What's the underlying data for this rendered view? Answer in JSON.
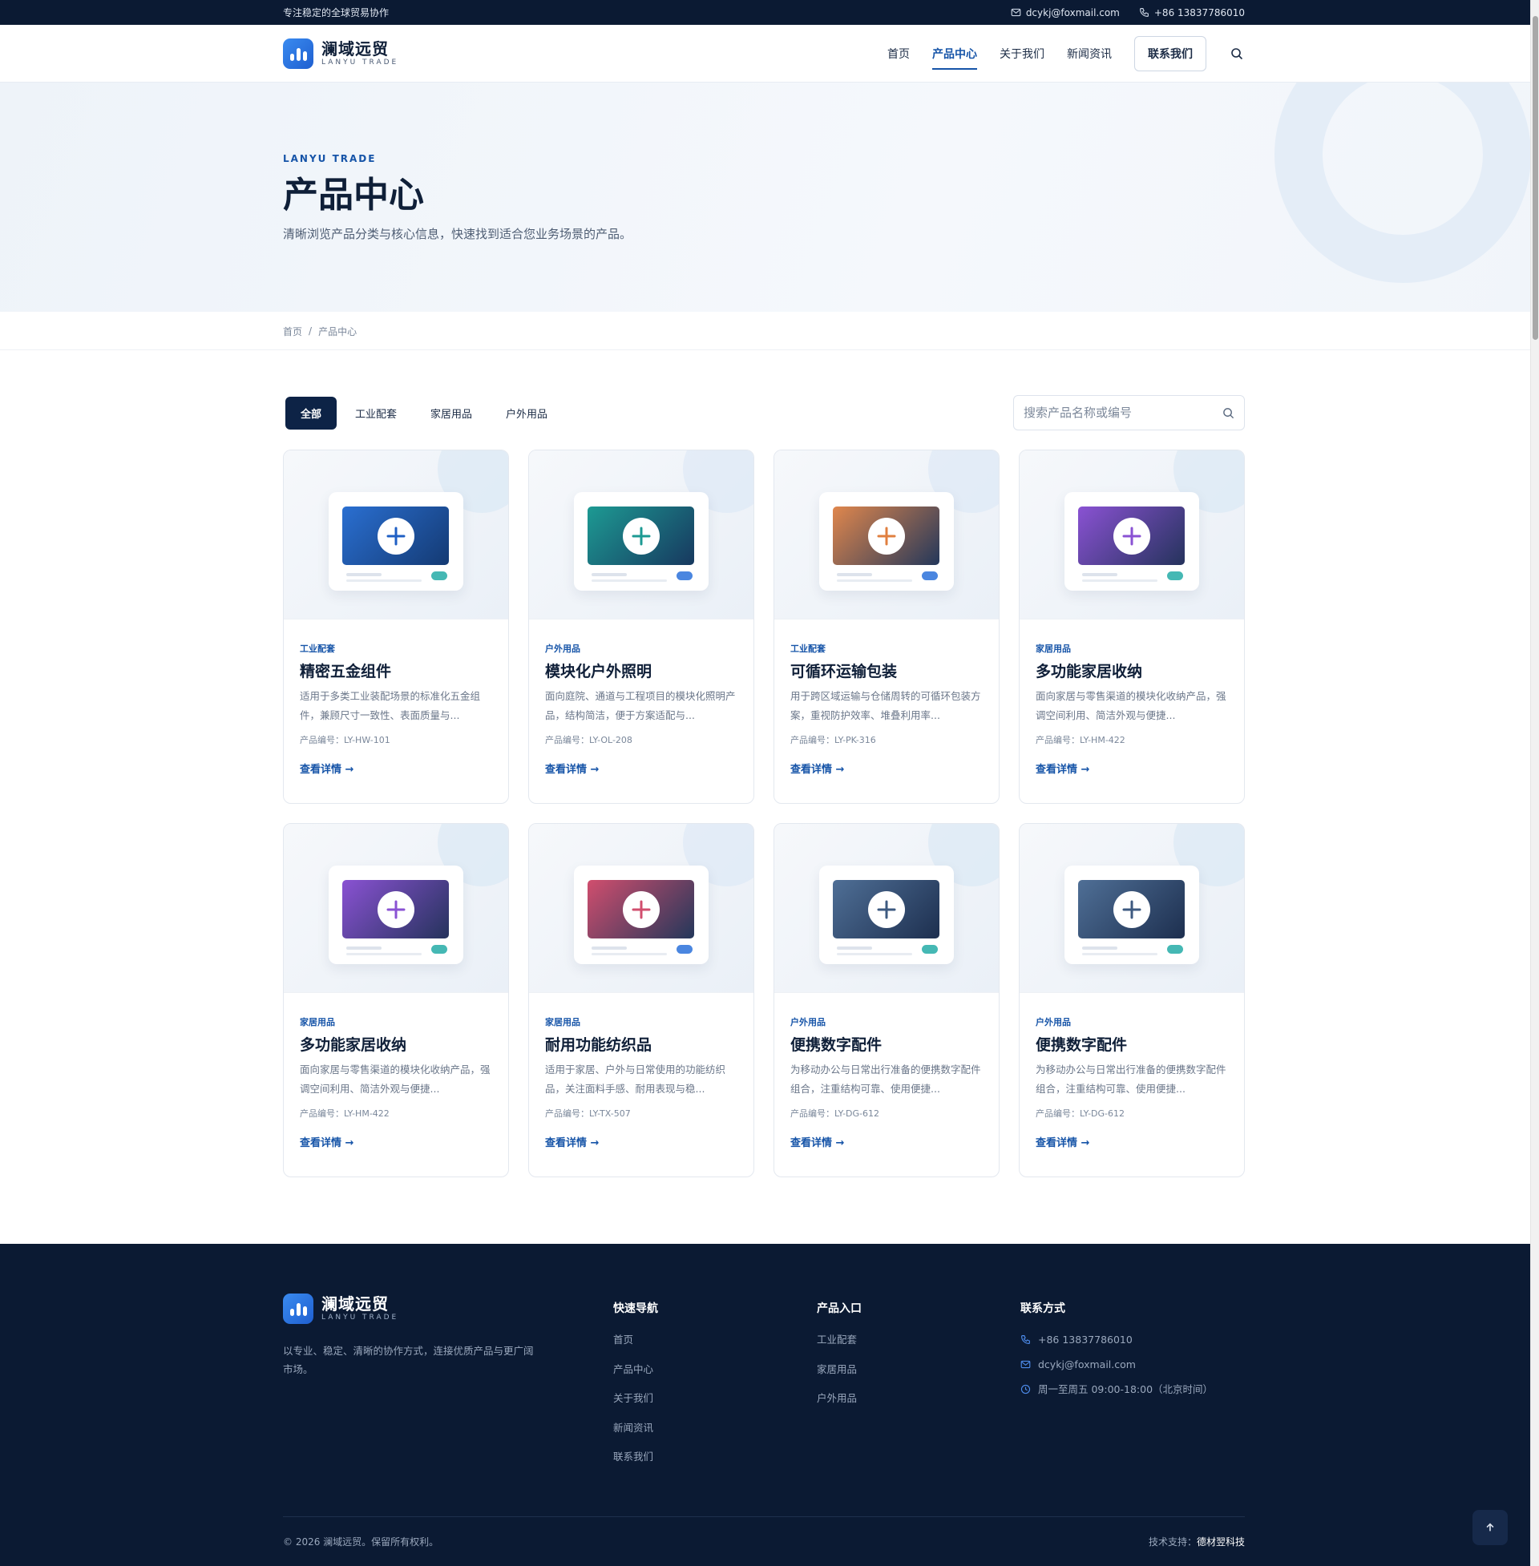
{
  "topbar": {
    "slogan": "专注稳定的全球贸易协作",
    "email": "dcykj@foxmail.com",
    "phone": "+86 13837786010"
  },
  "brand": {
    "name_cn": "澜域远贸",
    "name_en": "LANYU TRADE"
  },
  "nav": {
    "items": [
      "首页",
      "产品中心",
      "关于我们",
      "新闻资讯"
    ],
    "active_index": 1,
    "contact_label": "联系我们"
  },
  "hero": {
    "eyebrow": "LANYU TRADE",
    "title": "产品中心",
    "description": "清晰浏览产品分类与核心信息，快速找到适合您业务场景的产品。"
  },
  "breadcrumb": {
    "home": "首页",
    "separator": "/",
    "current": "产品中心"
  },
  "filters": {
    "tabs": [
      "全部",
      "工业配套",
      "家居用品",
      "户外用品"
    ],
    "active_index": 0,
    "search_placeholder": "搜索产品名称或编号"
  },
  "products": [
    {
      "tag": "工业配套",
      "title": "精密五金组件",
      "desc": "适用于多类工业装配场景的标准化五金组件，兼顾尺寸一致性、表面质量与...",
      "code": "产品编号：LY-HW-101",
      "link": "查看详情 →",
      "color_a": "#2a6fd1",
      "color_b": "#143a73",
      "plus_color": "#1f5fc4",
      "blob": "#d6e6f4",
      "pill": "#45b8b4"
    },
    {
      "tag": "户外用品",
      "title": "模块化户外照明",
      "desc": "面向庭院、通道与工程项目的模块化照明产品，结构简洁，便于方案适配与...",
      "code": "产品编号：LY-OL-208",
      "link": "查看详情 →",
      "color_a": "#1d9a93",
      "color_b": "#17385f",
      "plus_color": "#1d9a93",
      "blob": "#d9e5f5",
      "pill": "#4a86e0"
    },
    {
      "tag": "工业配套",
      "title": "可循环运输包装",
      "desc": "用于跨区域运输与仓储周转的可循环包装方案，重视防护效率、堆叠利用率...",
      "code": "产品编号：LY-PK-316",
      "link": "查看详情 →",
      "color_a": "#e0874d",
      "color_b": "#23375a",
      "plus_color": "#e07f3f",
      "blob": "#d9e5f5",
      "pill": "#4a86e0"
    },
    {
      "tag": "家居用品",
      "title": "多功能家居收纳",
      "desc": "面向家居与零售渠道的模块化收纳产品，强调空间利用、简洁外观与便捷...",
      "code": "产品编号：LY-HM-422",
      "link": "查看详情 →",
      "color_a": "#8a52d3",
      "color_b": "#25335c",
      "plus_color": "#8a52d3",
      "blob": "#d6e6f4",
      "pill": "#45b8b4"
    },
    {
      "tag": "家居用品",
      "title": "多功能家居收纳",
      "desc": "面向家居与零售渠道的模块化收纳产品，强调空间利用、简洁外观与便捷...",
      "code": "产品编号：LY-HM-422",
      "link": "查看详情 →",
      "color_a": "#8a52d3",
      "color_b": "#25335c",
      "plus_color": "#8a52d3",
      "blob": "#d6e6f4",
      "pill": "#45b8b4"
    },
    {
      "tag": "家居用品",
      "title": "耐用功能纺织品",
      "desc": "适用于家居、户外与日常使用的功能纺织品，关注面料手感、耐用表现与稳...",
      "code": "产品编号：LY-TX-507",
      "link": "查看详情 →",
      "color_a": "#d14e6e",
      "color_b": "#23375a",
      "plus_color": "#d14e6e",
      "blob": "#d9e5f5",
      "pill": "#4a86e0"
    },
    {
      "tag": "户外用品",
      "title": "便携数字配件",
      "desc": "为移动办公与日常出行准备的便携数字配件组合，注重结构可靠、使用便捷...",
      "code": "产品编号：LY-DG-612",
      "link": "查看详情 →",
      "color_a": "#4f6f96",
      "color_b": "#1d2f4f",
      "plus_color": "#3d5a80",
      "blob": "#d6e6f4",
      "pill": "#45b8b4"
    },
    {
      "tag": "户外用品",
      "title": "便携数字配件",
      "desc": "为移动办公与日常出行准备的便携数字配件组合，注重结构可靠、使用便捷...",
      "code": "产品编号：LY-DG-612",
      "link": "查看详情 →",
      "color_a": "#4f6f96",
      "color_b": "#1d2f4f",
      "plus_color": "#3d5a80",
      "blob": "#d6e6f4",
      "pill": "#45b8b4"
    }
  ],
  "footer": {
    "brand_desc": "以专业、稳定、清晰的协作方式，连接优质产品与更广阔市场。",
    "quick_nav": {
      "title": "快速导航",
      "items": [
        "首页",
        "产品中心",
        "关于我们",
        "新闻资讯",
        "联系我们"
      ]
    },
    "products": {
      "title": "产品入口",
      "items": [
        "工业配套",
        "家居用品",
        "户外用品"
      ]
    },
    "contact": {
      "title": "联系方式",
      "phone": "+86 13837786010",
      "email": "dcykj@foxmail.com",
      "hours": "周一至周五 09:00-18:00（北京时间）"
    },
    "copyright": "© 2026 澜域远贸。保留所有权利。",
    "support_label": "技术支持：",
    "support_name": "德材翌科技"
  },
  "colors": {
    "navy": "#0b1a33",
    "accent": "#1654a8",
    "active_tab": "#0d2346"
  }
}
